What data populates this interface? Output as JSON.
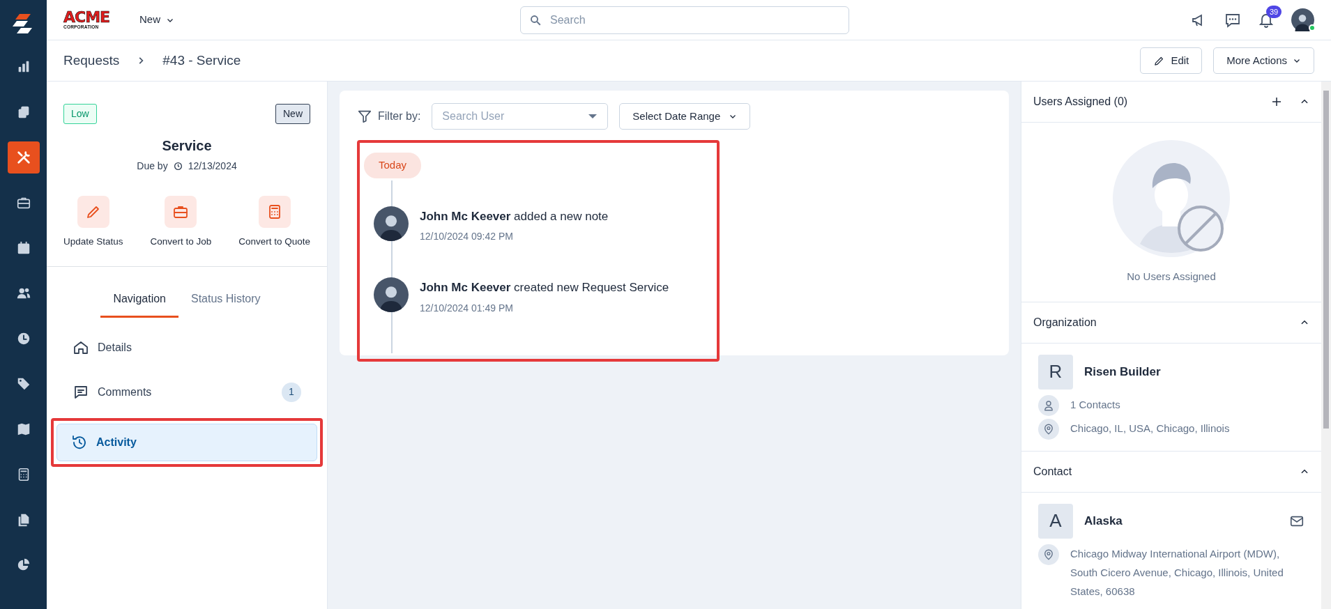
{
  "rail": {
    "items": [
      {
        "kind": "chart",
        "selected": false
      },
      {
        "kind": "clipboard",
        "selected": false
      },
      {
        "kind": "tools",
        "selected": true
      },
      {
        "kind": "briefcase",
        "selected": false
      },
      {
        "kind": "calendar",
        "selected": false
      },
      {
        "kind": "people",
        "selected": false
      },
      {
        "kind": "clock",
        "selected": false
      },
      {
        "kind": "tag",
        "selected": false
      },
      {
        "kind": "map",
        "selected": false
      },
      {
        "kind": "calculator",
        "selected": false
      },
      {
        "kind": "files",
        "selected": false
      },
      {
        "kind": "pie",
        "selected": false
      }
    ]
  },
  "header": {
    "logo": {
      "name": "ACME",
      "subtitle": "CORPORATION"
    },
    "new_menu": "New",
    "search": {
      "placeholder": "Search"
    },
    "notifications": "39",
    "user_online": true
  },
  "breadcrumb": [
    "Requests",
    "#43 - Service"
  ],
  "page_actions": {
    "edit": "Edit",
    "more": "More Actions"
  },
  "request": {
    "priority": "Low",
    "status": "New",
    "title": "Service",
    "due_label": "Due by",
    "due_date": "12/13/2024",
    "actions": [
      {
        "kind": "pencil",
        "label": "Update Status"
      },
      {
        "kind": "briefcase",
        "label": "Convert to Job"
      },
      {
        "kind": "calculator",
        "label": "Convert to Quote"
      }
    ],
    "tabs": [
      {
        "label": "Navigation",
        "selected": true
      },
      {
        "label": "Status History",
        "selected": false
      }
    ],
    "nav_items": [
      {
        "kind": "home",
        "label": "Details",
        "selected": false,
        "highlighted": false
      },
      {
        "kind": "comment",
        "label": "Comments",
        "count": "1",
        "selected": false,
        "highlighted": false
      },
      {
        "kind": "history",
        "label": "Activity",
        "selected": true,
        "highlighted": true
      }
    ]
  },
  "activity": {
    "filter_label": "Filter by:",
    "user_select": {
      "placeholder": "Search User"
    },
    "date_button": "Select Date Range",
    "highlighted": true,
    "groups": [
      {
        "label": "Today",
        "entries": [
          {
            "text": "**John Mc Keever** added a new note",
            "time": "12/10/2024 09:42 PM"
          },
          {
            "text": "**John Mc Keever** created new Request Service",
            "time": "12/10/2024 01:49 PM"
          }
        ]
      }
    ]
  },
  "users_assigned": {
    "title": "Users Assigned (0)",
    "expanded": true,
    "empty": "No Users Assigned"
  },
  "organization": {
    "title": "Organization",
    "expanded": true,
    "initial": "R",
    "name": "Risen Builder",
    "details": [
      {
        "kind": "person",
        "text": "1 Contacts"
      },
      {
        "kind": "pin",
        "text": "Chicago, IL, USA, Chicago, Illinois"
      }
    ]
  },
  "contact": {
    "title": "Contact",
    "expanded": true,
    "initial": "A",
    "name": "Alaska",
    "details": [
      {
        "kind": "pin",
        "text": "Chicago Midway International Airport (MDW), South Cicero Avenue, Chicago, Illinois, United States, 60638"
      }
    ]
  }
}
